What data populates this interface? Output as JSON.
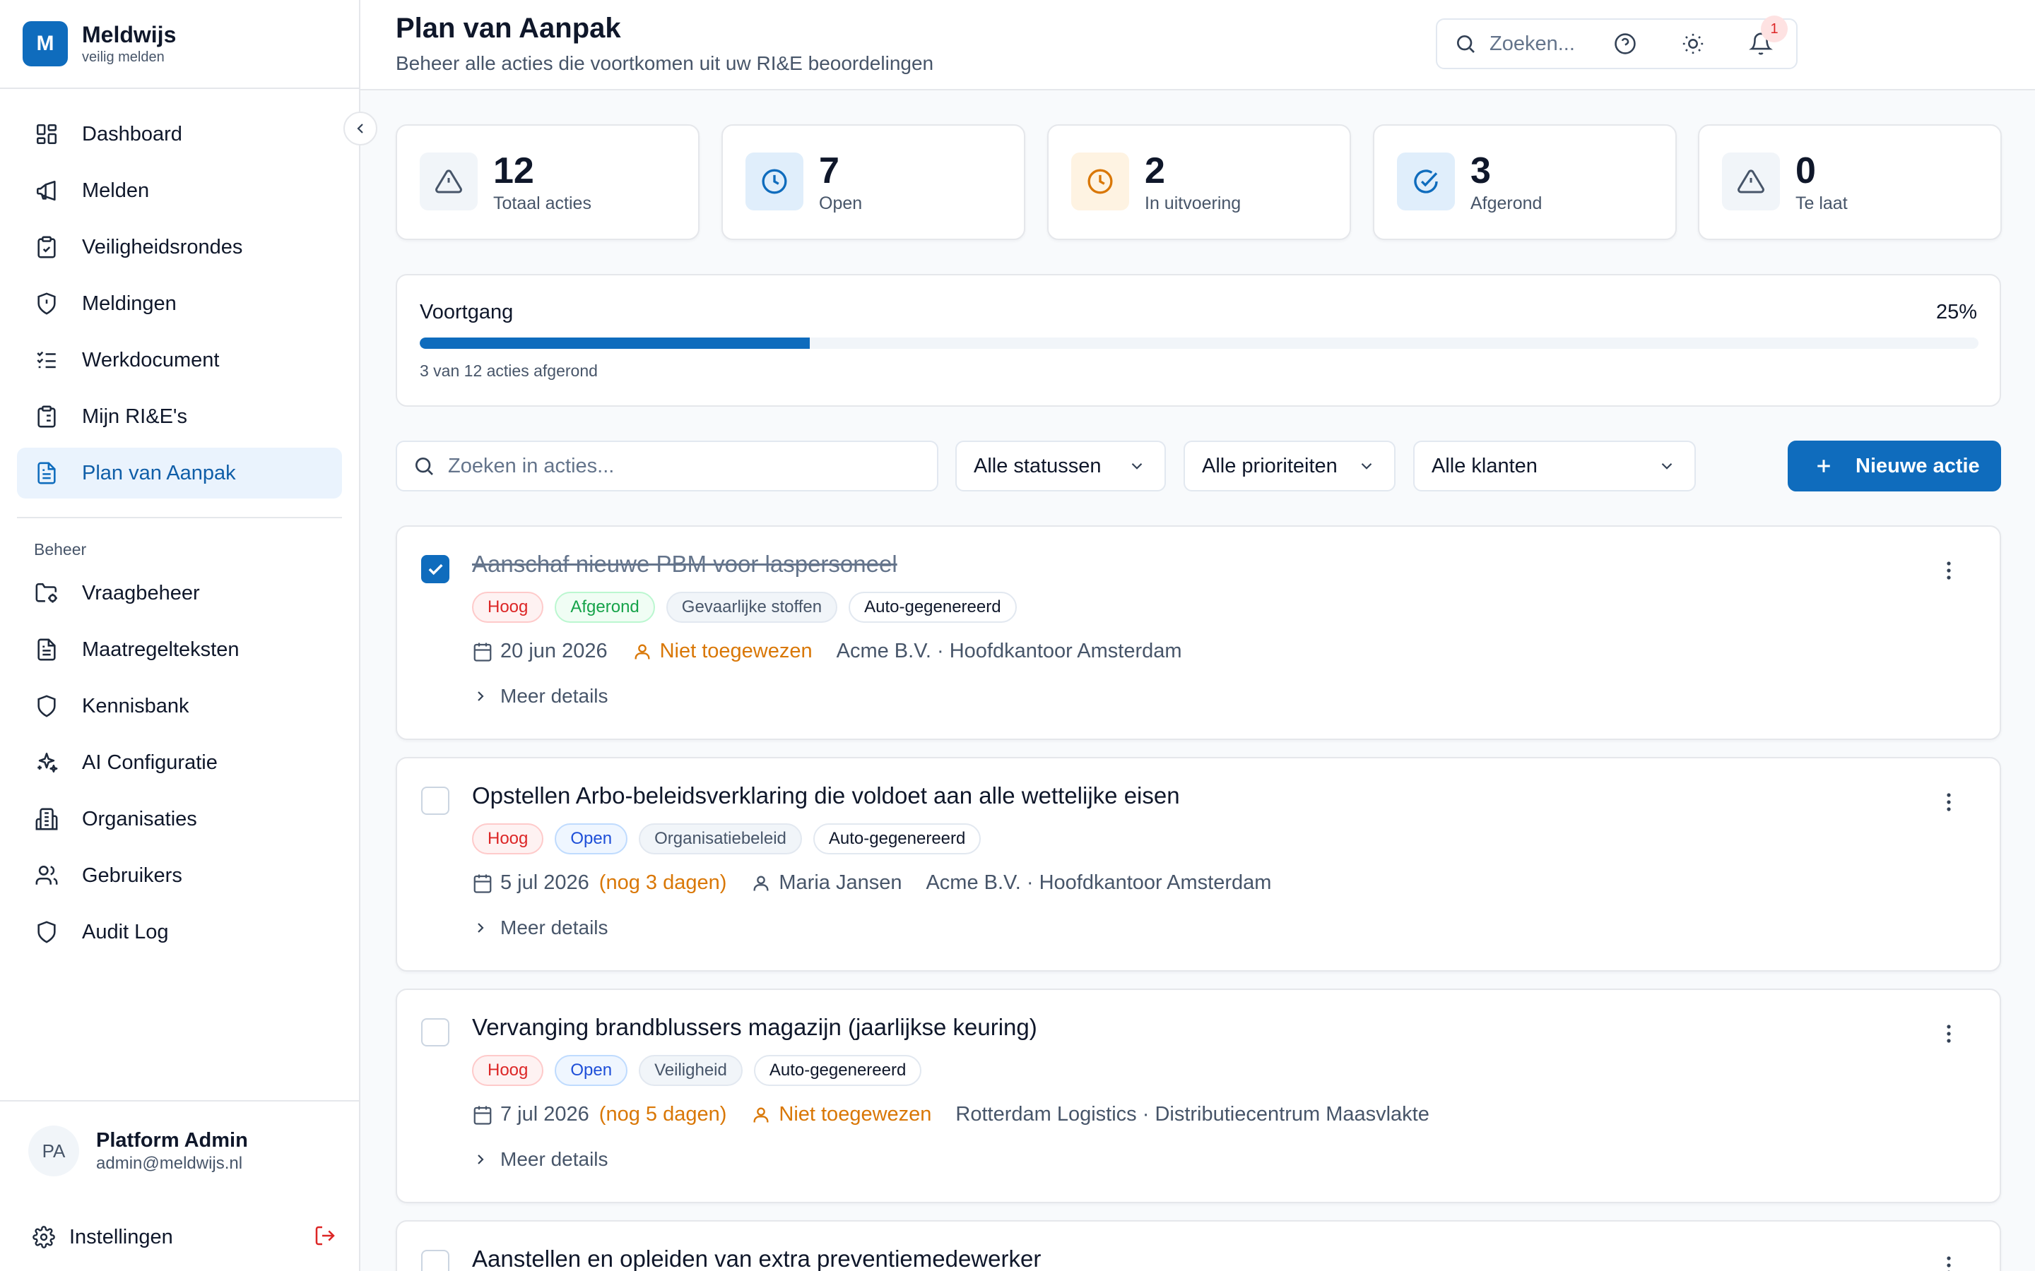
{
  "app": {
    "name": "Meldwijs",
    "tagline": "veilig melden",
    "logo_letter": "M"
  },
  "sidebar": {
    "main_items": [
      {
        "label": "Dashboard",
        "icon": "dashboard-icon"
      },
      {
        "label": "Melden",
        "icon": "megaphone-icon"
      },
      {
        "label": "Veiligheidsrondes",
        "icon": "clipboard-check-icon"
      },
      {
        "label": "Meldingen",
        "icon": "shield-alert-icon"
      },
      {
        "label": "Werkdocument",
        "icon": "list-checks-icon"
      },
      {
        "label": "Mijn RI&E's",
        "icon": "clipboard-list-icon"
      },
      {
        "label": "Plan van Aanpak",
        "icon": "file-text-icon",
        "active": true
      }
    ],
    "section_label": "Beheer",
    "admin_items": [
      {
        "label": "Vraagbeheer",
        "icon": "folder-cog-icon"
      },
      {
        "label": "Maatregelteksten",
        "icon": "file-text-icon"
      },
      {
        "label": "Kennisbank",
        "icon": "shield-icon"
      },
      {
        "label": "AI Configuratie",
        "icon": "sparkles-icon"
      },
      {
        "label": "Organisaties",
        "icon": "building-icon"
      },
      {
        "label": "Gebruikers",
        "icon": "users-icon"
      },
      {
        "label": "Audit Log",
        "icon": "shield-icon"
      }
    ],
    "user": {
      "initials": "PA",
      "name": "Platform Admin",
      "email": "admin@meldwijs.nl"
    },
    "settings_label": "Instellingen"
  },
  "header": {
    "title": "Plan van Aanpak",
    "subtitle": "Beheer alle acties die voortkomen uit uw RI&E beoordelingen",
    "search_placeholder": "Zoeken...",
    "notification_count": "1"
  },
  "stats": [
    {
      "value": "12",
      "label": "Totaal acties",
      "icon": "alert-triangle-icon",
      "color": "#475569",
      "bg": "#f1f5f9"
    },
    {
      "value": "7",
      "label": "Open",
      "icon": "clock-icon",
      "color": "#0f6cbd",
      "bg": "#e0eefb"
    },
    {
      "value": "2",
      "label": "In uitvoering",
      "icon": "clock-icon",
      "color": "#d97706",
      "bg": "#fef3e2"
    },
    {
      "value": "3",
      "label": "Afgerond",
      "icon": "check-circle-icon",
      "color": "#0f6cbd",
      "bg": "#e0eefb"
    },
    {
      "value": "0",
      "label": "Te laat",
      "icon": "alert-triangle-icon",
      "color": "#475569",
      "bg": "#f1f5f9"
    }
  ],
  "progress": {
    "title": "Voortgang",
    "percent_label": "25%",
    "fraction": 0.25,
    "note": "3 van 12 acties afgerond"
  },
  "filters": {
    "search_placeholder": "Zoeken in acties...",
    "status": "Alle statussen",
    "priority": "Alle prioriteiten",
    "client": "Alle klanten",
    "new_button": "Nieuwe actie"
  },
  "actions": [
    {
      "title": "Aanschaf nieuwe PBM voor laspersoneel",
      "checked": true,
      "tags": [
        {
          "text": "Hoog",
          "kind": "high"
        },
        {
          "text": "Afgerond",
          "kind": "done"
        },
        {
          "text": "Gevaarlijke stoffen",
          "kind": "cat"
        },
        {
          "text": "Auto-gegenereerd",
          "kind": "auto"
        }
      ],
      "date": "20 jun 2026",
      "due_note": "",
      "assignee": "Niet toegewezen",
      "unassigned": true,
      "location": "Acme B.V. · Hoofdkantoor Amsterdam",
      "more": "Meer details"
    },
    {
      "title": "Opstellen Arbo-beleidsverklaring die voldoet aan alle wettelijke eisen",
      "checked": false,
      "tags": [
        {
          "text": "Hoog",
          "kind": "high"
        },
        {
          "text": "Open",
          "kind": "open"
        },
        {
          "text": "Organisatiebeleid",
          "kind": "cat"
        },
        {
          "text": "Auto-gegenereerd",
          "kind": "auto"
        }
      ],
      "date": "5 jul 2026",
      "due_note": "(nog 3 dagen)",
      "assignee": "Maria Jansen",
      "unassigned": false,
      "location": "Acme B.V. · Hoofdkantoor Amsterdam",
      "more": "Meer details"
    },
    {
      "title": "Vervanging brandblussers magazijn (jaarlijkse keuring)",
      "checked": false,
      "tags": [
        {
          "text": "Hoog",
          "kind": "high"
        },
        {
          "text": "Open",
          "kind": "open"
        },
        {
          "text": "Veiligheid",
          "kind": "cat"
        },
        {
          "text": "Auto-gegenereerd",
          "kind": "auto"
        }
      ],
      "date": "7 jul 2026",
      "due_note": "(nog 5 dagen)",
      "assignee": "Niet toegewezen",
      "unassigned": true,
      "location": "Rotterdam Logistics · Distributiecentrum Maasvlakte",
      "more": "Meer details"
    },
    {
      "title": "Aanstellen en opleiden van extra preventiemedewerker",
      "checked": false,
      "tags": [],
      "date": "",
      "due_note": "",
      "assignee": "",
      "unassigned": false,
      "location": "",
      "more": ""
    }
  ]
}
